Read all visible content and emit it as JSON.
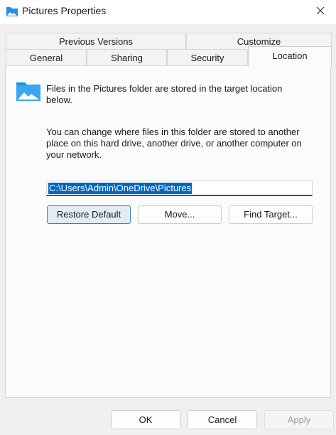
{
  "window": {
    "title": "Pictures Properties"
  },
  "tabs": {
    "previous_versions": "Previous Versions",
    "customize": "Customize",
    "general": "General",
    "sharing": "Sharing",
    "security": "Security",
    "location": "Location"
  },
  "location": {
    "info": "Files in the Pictures folder are stored in the target location below.",
    "change_text": "You can change where files in this folder are stored to another place on this hard drive, another drive, or another computer on your network.",
    "path": "C:\\Users\\Admin\\OneDrive\\Pictures",
    "restore_label": "Restore Default",
    "move_label": "Move...",
    "find_label": "Find Target..."
  },
  "footer": {
    "ok_label": "OK",
    "cancel_label": "Cancel",
    "apply_label": "Apply"
  },
  "colors": {
    "accent": "#0067c0",
    "folder": "#1e90e6"
  }
}
